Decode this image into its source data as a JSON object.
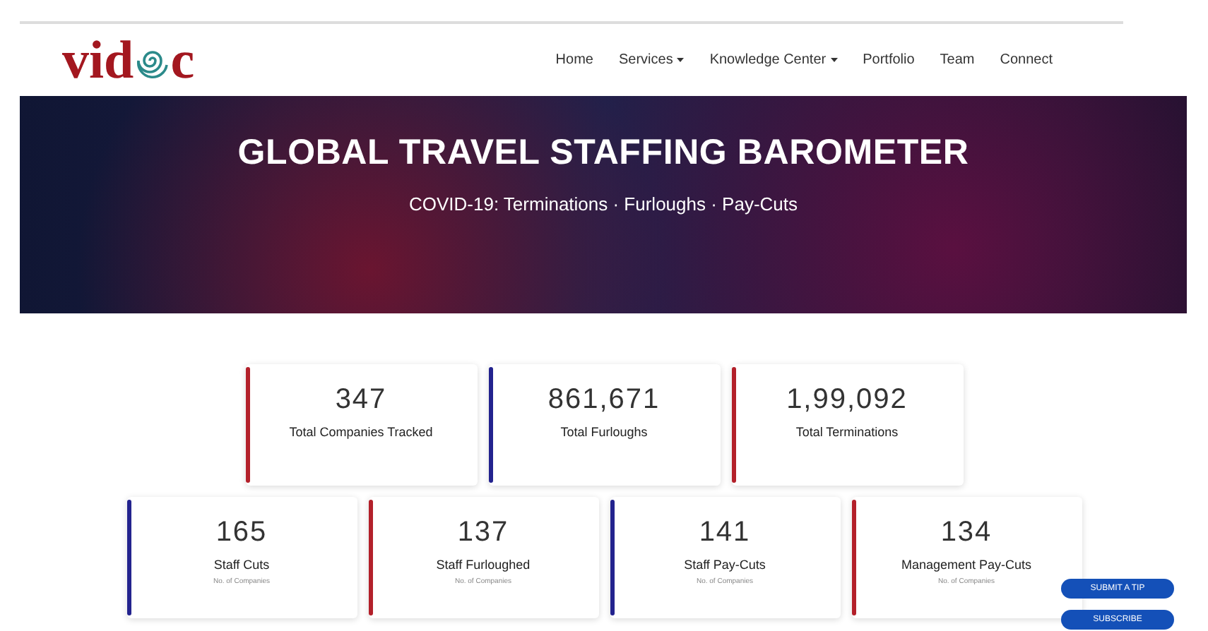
{
  "logo": {
    "before": "vid",
    "after": "c"
  },
  "nav": [
    {
      "label": "Home",
      "dropdown": false
    },
    {
      "label": "Services",
      "dropdown": true
    },
    {
      "label": "Knowledge Center",
      "dropdown": true
    },
    {
      "label": "Portfolio",
      "dropdown": false
    },
    {
      "label": "Team",
      "dropdown": false
    },
    {
      "label": "Connect",
      "dropdown": false
    }
  ],
  "hero": {
    "title": "GLOBAL TRAVEL STAFFING BAROMETER",
    "subtitle": "COVID-19: Terminations · Furloughs · Pay-Cuts"
  },
  "totals": [
    {
      "value": "347",
      "label": "Total Companies Tracked",
      "color": "#b3202a"
    },
    {
      "value": "861,671",
      "label": "Total Furloughs",
      "color": "#23238e"
    },
    {
      "value": "1,99,092",
      "label": "Total Terminations",
      "color": "#b3202a"
    }
  ],
  "breakdown": [
    {
      "value": "165",
      "label": "Staff Cuts",
      "note": "No. of Companies",
      "color": "#23238e"
    },
    {
      "value": "137",
      "label": "Staff Furloughed",
      "note": "No. of Companies",
      "color": "#b3202a"
    },
    {
      "value": "141",
      "label": "Staff Pay-Cuts",
      "note": "No. of Companies",
      "color": "#23238e"
    },
    {
      "value": "134",
      "label": "Management Pay-Cuts",
      "note": "No. of Companies",
      "color": "#b3202a"
    }
  ],
  "floating_buttons": [
    "SUBMIT A TIP",
    "SUBSCRIBE"
  ]
}
